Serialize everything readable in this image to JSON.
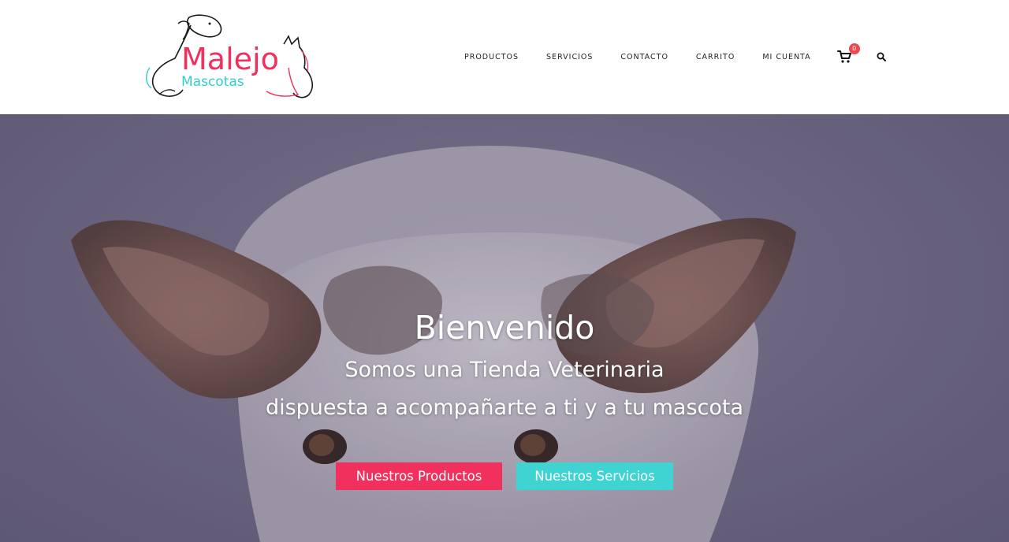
{
  "header": {
    "logo": {
      "main": "Malejo",
      "sub": "Mascotas",
      "main_color": "#f1305e",
      "sub_color": "#2ed1ce"
    },
    "nav": [
      {
        "label": "PRODUCTOS"
      },
      {
        "label": "SERVICIOS"
      },
      {
        "label": "CONTACTO"
      },
      {
        "label": "CARRITO"
      },
      {
        "label": "MI CUENTA"
      }
    ],
    "cart": {
      "icon": "cart-icon",
      "count": "0",
      "badge_color": "#f0484f"
    },
    "search": {
      "icon": "search-icon"
    }
  },
  "hero": {
    "title": "Bienvenido",
    "line1": "Somos una Tienda Veterinaria",
    "line2": "dispuesta a acompañarte a ti y a tu mascota",
    "buttons": [
      {
        "label": "Nuestros Productos",
        "color": "#f1305e"
      },
      {
        "label": "Nuestros Servicios",
        "color": "#3fd3d1"
      }
    ]
  }
}
